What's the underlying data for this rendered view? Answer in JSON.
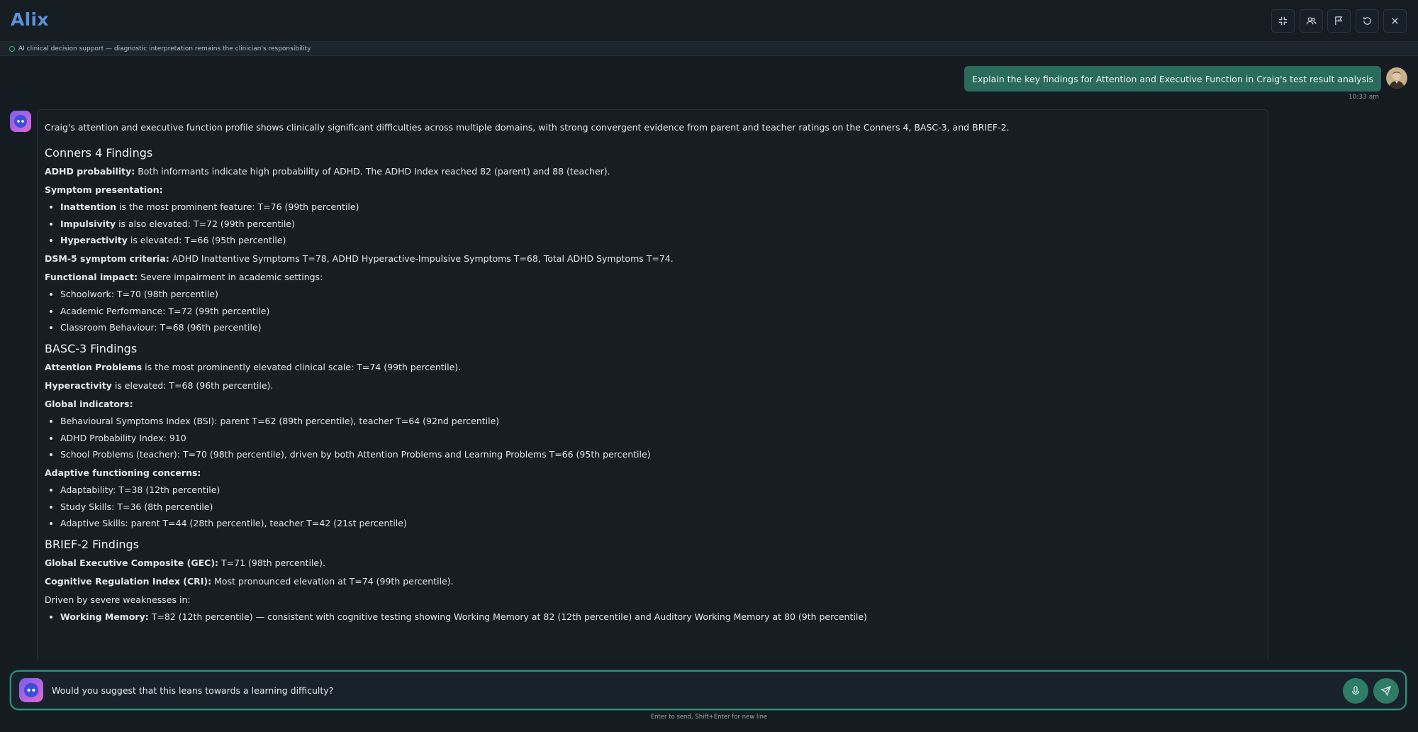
{
  "app": {
    "title": "Alix"
  },
  "header_buttons": [
    {
      "name": "collapse-icon"
    },
    {
      "name": "users-icon"
    },
    {
      "name": "flag-icon"
    },
    {
      "name": "refresh-icon"
    },
    {
      "name": "close-icon"
    }
  ],
  "disclaimer": "AI clinical decision support — diagnostic interpretation remains the clinician's responsibility",
  "user_message": {
    "text": "Explain the key findings for Attention and Executive Function in Craig's test result analysis",
    "time": "10:33 am"
  },
  "response": {
    "intro": "Craig's attention and executive function profile shows clinically significant difficulties across multiple domains, with strong convergent evidence from parent and teacher ratings on the Conners 4, BASC-3, and BRIEF-2.",
    "conners": {
      "heading": "Conners 4 Findings",
      "adhd_label": "ADHD probability:",
      "adhd_text": " Both informants indicate high probability of ADHD. The ADHD Index reached 82 (parent) and 88 (teacher).",
      "symptom_label": "Symptom presentation:",
      "symptoms": [
        {
          "b": "Inattention",
          "t": " is the most prominent feature: T=76 (99th percentile)"
        },
        {
          "b": "Impulsivity",
          "t": " is also elevated: T=72 (99th percentile)"
        },
        {
          "b": "Hyperactivity",
          "t": " is elevated: T=66 (95th percentile)"
        }
      ],
      "dsm_label": "DSM-5 symptom criteria:",
      "dsm_text": " ADHD Inattentive Symptoms T=78, ADHD Hyperactive-Impulsive Symptoms T=68, Total ADHD Symptoms T=74.",
      "func_label": "Functional impact:",
      "func_text": " Severe impairment in academic settings:",
      "functional": [
        "Schoolwork: T=70 (98th percentile)",
        "Academic Performance: T=72 (99th percentile)",
        "Classroom Behaviour: T=68 (96th percentile)"
      ]
    },
    "basc": {
      "heading": "BASC-3 Findings",
      "attn_label": "Attention Problems",
      "attn_text": " is the most prominently elevated clinical scale: T=74 (99th percentile).",
      "hyper_label": "Hyperactivity",
      "hyper_text": " is elevated: T=68 (96th percentile).",
      "global_label": "Global indicators:",
      "global": [
        "Behavioural Symptoms Index (BSI): parent T=62 (89th percentile), teacher T=64 (92nd percentile)",
        "ADHD Probability Index: 910",
        "School Problems (teacher): T=70 (98th percentile), driven by both Attention Problems and Learning Problems T=66 (95th percentile)"
      ],
      "adaptive_label": "Adaptive functioning concerns:",
      "adaptive": [
        "Adaptability: T=38 (12th percentile)",
        "Study Skills: T=36 (8th percentile)",
        "Adaptive Skills: parent T=44 (28th percentile), teacher T=42 (21st percentile)"
      ]
    },
    "brief": {
      "heading": "BRIEF-2 Findings",
      "gec_label": "Global Executive Composite (GEC):",
      "gec_text": " T=71 (98th percentile).",
      "cri_label": "Cognitive Regulation Index (CRI):",
      "cri_text": " Most pronounced elevation at T=74 (99th percentile).",
      "driven": "Driven by severe weaknesses in:",
      "wm_label": "Working Memory:",
      "wm_text": " T=82 (12th percentile) — consistent with cognitive testing showing Working Memory at 82 (12th percentile) and Auditory Working Memory at 80 (9th percentile)"
    }
  },
  "composer": {
    "value": "Would you suggest that this leans towards a learning difficulty?",
    "hint": "Enter to send, Shift+Enter for new line"
  },
  "colors": {
    "accent": "#2e7b66",
    "brand": "#5b8fd8",
    "user_bubble": "#2a6b5c"
  }
}
